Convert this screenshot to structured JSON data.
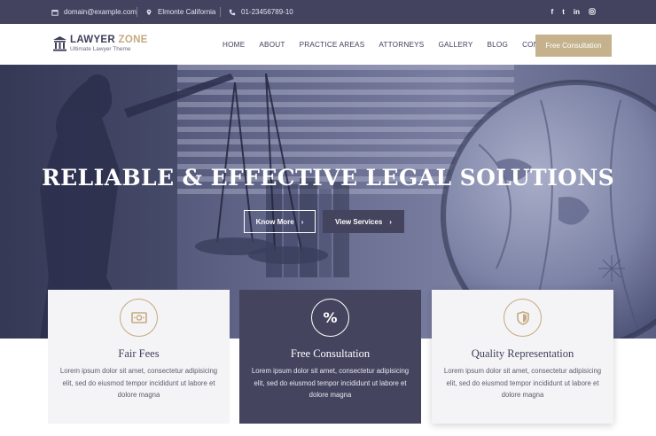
{
  "topbar": {
    "email": "domain@example.com",
    "location": "Elmonte California",
    "phone": "01-23456789-10",
    "social": [
      "f",
      "t",
      "in",
      "ig"
    ]
  },
  "header": {
    "logo_main": "LAWYER",
    "logo_accent": "ZONE",
    "logo_sub": "Ultimate Lawyer Theme",
    "nav": [
      "HOME",
      "ABOUT",
      "PRACTICE AREAS",
      "ATTORNEYS",
      "GALLERY",
      "BLOG",
      "CONTACT"
    ],
    "cta": "Free Consultation"
  },
  "hero": {
    "title": "RELIABLE & EFFECTIVE LEGAL SOLUTIONS",
    "btn_primary": "Know More",
    "btn_secondary": "View Services",
    "arrow": "›"
  },
  "features": [
    {
      "title": "Fair Fees",
      "text": "Lorem ipsum dolor sit amet, consectetur adipisicing elit, sed do eiusmod tempor incididunt ut labore et dolore magna",
      "icon": "money-icon"
    },
    {
      "title": "Free Consultation",
      "text": "Lorem ipsum dolor sit amet, consectetur adipisicing elit, sed do eiusmod tempor incididunt ut labore et dolore magna",
      "icon": "percent-icon",
      "icon_glyph": "%"
    },
    {
      "title": "Quality Representation",
      "text": "Lorem ipsum dolor sit amet, consectetur adipisicing elit, sed do eiusmod tempor incididunt ut labore et dolore magna",
      "icon": "shield-icon"
    }
  ],
  "colors": {
    "navy": "#434360",
    "gold": "#c5a97f",
    "cta": "#c5b28c"
  }
}
